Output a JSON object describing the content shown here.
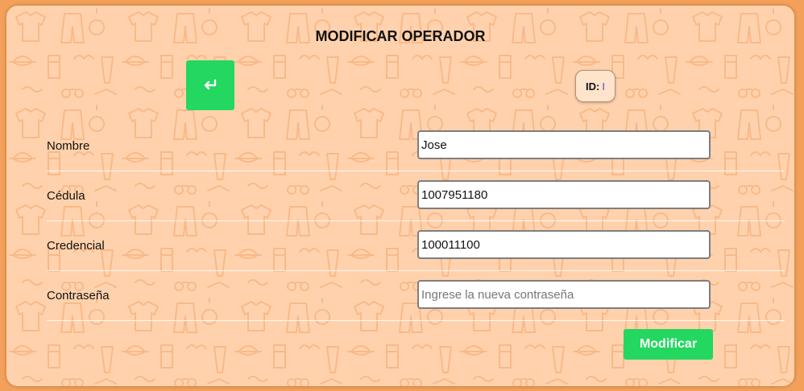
{
  "page": {
    "title": "MODIFICAR OPERADOR",
    "back_icon": "return-arrow-icon",
    "background_pattern": "clothing-accessories-pattern"
  },
  "id_badge": {
    "label": "ID:",
    "value": "I"
  },
  "form": {
    "fields": [
      {
        "label": "Nombre",
        "value": "Jose",
        "placeholder": ""
      },
      {
        "label": "Cédula",
        "value": "1007951180",
        "placeholder": ""
      },
      {
        "label": "Credencial",
        "value": "100011100",
        "placeholder": ""
      },
      {
        "label": "Contraseña",
        "value": "",
        "placeholder": "Ingrese la nueva contraseña"
      }
    ],
    "submit_label": "Modificar"
  },
  "colors": {
    "outer_background": "#f2a05a",
    "panel_background": "#ffd2ad",
    "accent_green": "#23d760",
    "pattern_stroke": "#f4a56a",
    "id_value_color": "#4a4ae8"
  }
}
